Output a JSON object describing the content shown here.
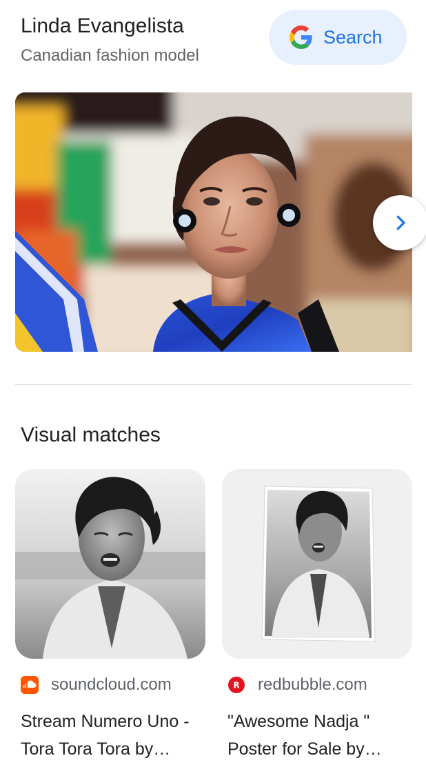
{
  "header": {
    "title": "Linda Evangelista",
    "subtitle": "Canadian fashion model",
    "search_label": "Search"
  },
  "section": {
    "title": "Visual matches"
  },
  "matches": [
    {
      "source": "soundcloud.com",
      "title": "Stream Numero Uno - Tora Tora Tora by…"
    },
    {
      "source": "redbubble.com",
      "title": "\"Awesome Nadja \" Poster for Sale by…"
    }
  ],
  "colors": {
    "accent": "#1a73e8",
    "search_bg": "#e8f0fe",
    "text": "#202124",
    "muted": "#5f6368",
    "soundcloud": "#ff5500",
    "redbubble": "#e41321"
  },
  "icons": {
    "search": "google-g-icon",
    "next": "chevron-right-icon",
    "soundcloud": "soundcloud-favicon",
    "redbubble": "redbubble-favicon"
  }
}
